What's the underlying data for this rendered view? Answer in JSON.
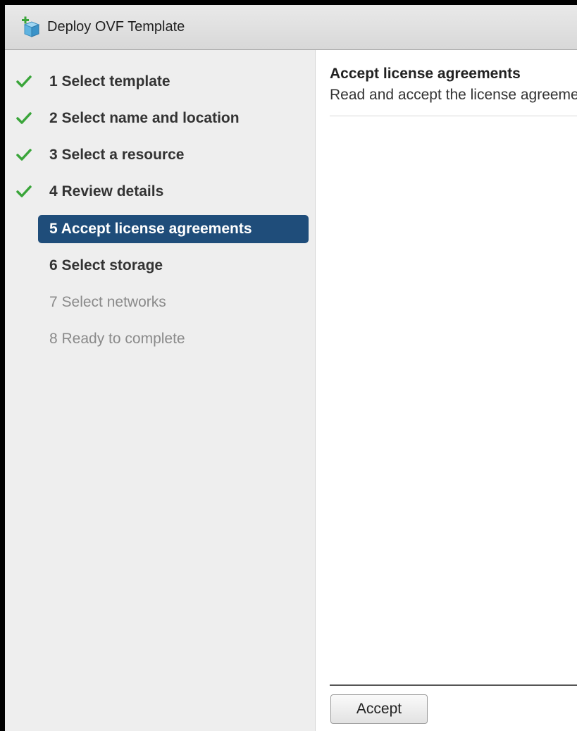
{
  "window": {
    "title": "Deploy OVF Template",
    "icon": "ovf-template-icon"
  },
  "colors": {
    "active_step_bg": "#1f4d7a",
    "check_green": "#3aa53a",
    "future_step_text": "#8a8a8a"
  },
  "steps": [
    {
      "label": "1  Select template",
      "state": "completed"
    },
    {
      "label": "2  Select name and location",
      "state": "completed"
    },
    {
      "label": "3  Select a resource",
      "state": "completed"
    },
    {
      "label": "4  Review details",
      "state": "completed"
    },
    {
      "label": "5  Accept license agreements",
      "state": "active"
    },
    {
      "label": "6  Select storage",
      "state": "upcoming"
    },
    {
      "label": "7  Select networks",
      "state": "disabled"
    },
    {
      "label": "8  Ready to complete",
      "state": "disabled"
    }
  ],
  "main": {
    "title": "Accept license agreements",
    "subtitle": "Read and accept the license agreements associated with this template before continuing.",
    "accept_label": "Accept"
  }
}
